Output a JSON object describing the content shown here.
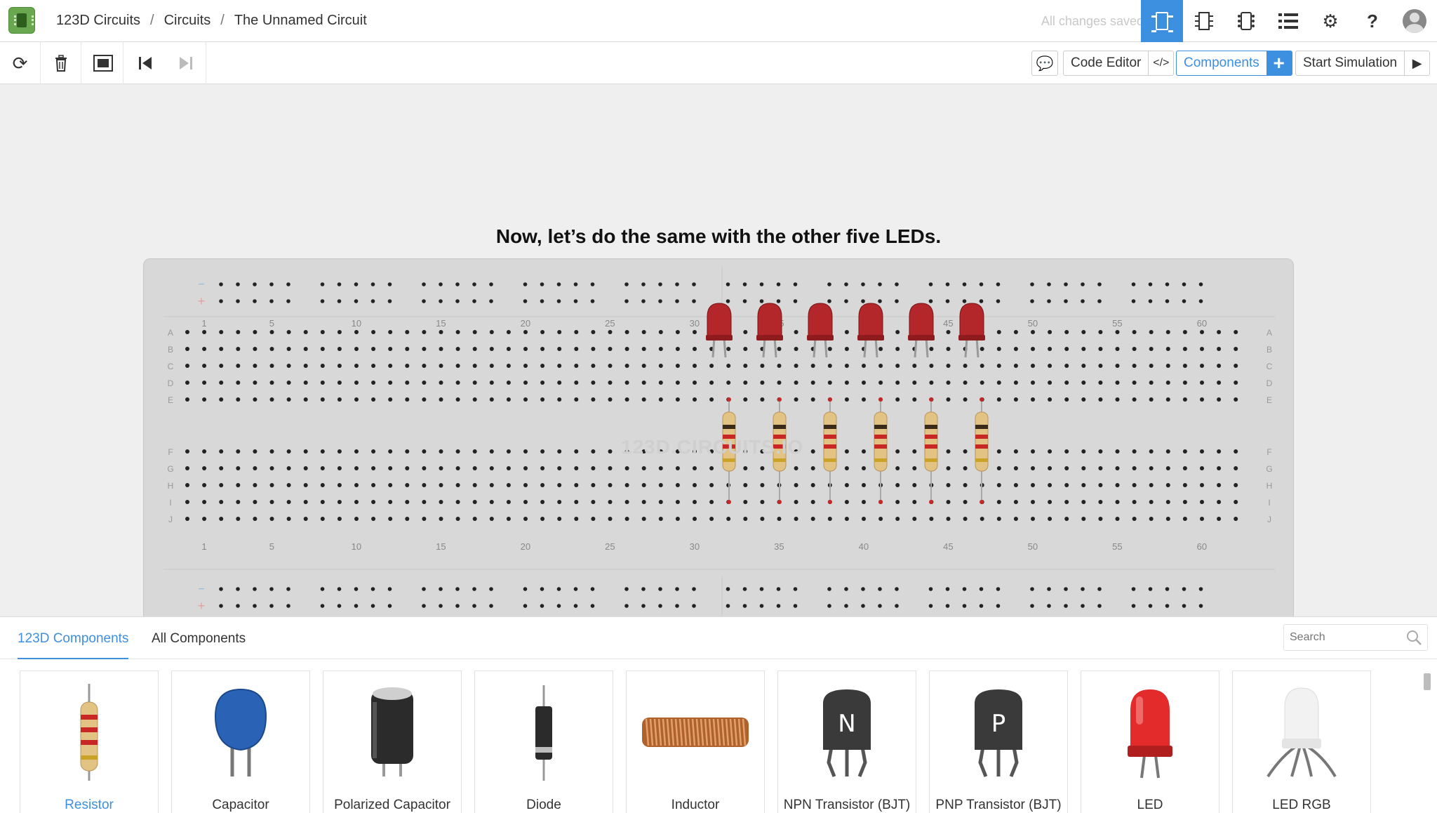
{
  "app": {
    "breadcrumb": [
      "123D Circuits",
      "Circuits",
      "The Unnamed Circuit"
    ],
    "save_status": "All changes saved"
  },
  "topbar_icons": [
    "breadboard-view-icon",
    "schematic-view-icon",
    "pcb-view-icon",
    "list-view-icon",
    "gear-icon",
    "help-icon",
    "user-icon"
  ],
  "toolbar": {
    "code_editor_label": "Code Editor",
    "components_label": "Components",
    "start_simulation_label": "Start Simulation"
  },
  "canvas": {
    "instruction": "Now, let’s do the same with the other five LEDs.",
    "watermark": "123D.CIRCUITS.IO"
  },
  "breadboard": {
    "column_labels": [
      "1",
      "5",
      "10",
      "15",
      "20",
      "25",
      "30",
      "35",
      "40",
      "45",
      "50",
      "55",
      "60"
    ],
    "row_labels_top": [
      "A",
      "B",
      "C",
      "D",
      "E"
    ],
    "row_labels_bottom": [
      "F",
      "G",
      "H",
      "I",
      "J"
    ],
    "rail_labels": [
      "−",
      "+"
    ],
    "led_count": 6,
    "resistor_count": 6,
    "colors": {
      "led": "#b3262a",
      "resistor_body": "#e2c383",
      "accent": "#3d8fe0"
    }
  },
  "panel": {
    "tabs": [
      "123D Components",
      "All Components"
    ],
    "search_placeholder": "Search",
    "components": [
      {
        "name": "Resistor",
        "icon": "resistor-icon",
        "selected": true
      },
      {
        "name": "Capacitor",
        "icon": "capacitor-icon",
        "selected": false
      },
      {
        "name": "Polarized Capacitor",
        "icon": "polarized-capacitor-icon",
        "selected": false
      },
      {
        "name": "Diode",
        "icon": "diode-icon",
        "selected": false
      },
      {
        "name": "Inductor",
        "icon": "inductor-icon",
        "selected": false
      },
      {
        "name": "NPN Transistor (BJT)",
        "icon": "npn-transistor-icon",
        "selected": false,
        "letter": "N"
      },
      {
        "name": "PNP Transistor (BJT)",
        "icon": "pnp-transistor-icon",
        "selected": false,
        "letter": "P"
      },
      {
        "name": "LED",
        "icon": "led-icon",
        "selected": false
      },
      {
        "name": "LED RGB",
        "icon": "led-rgb-icon",
        "selected": false
      }
    ]
  }
}
